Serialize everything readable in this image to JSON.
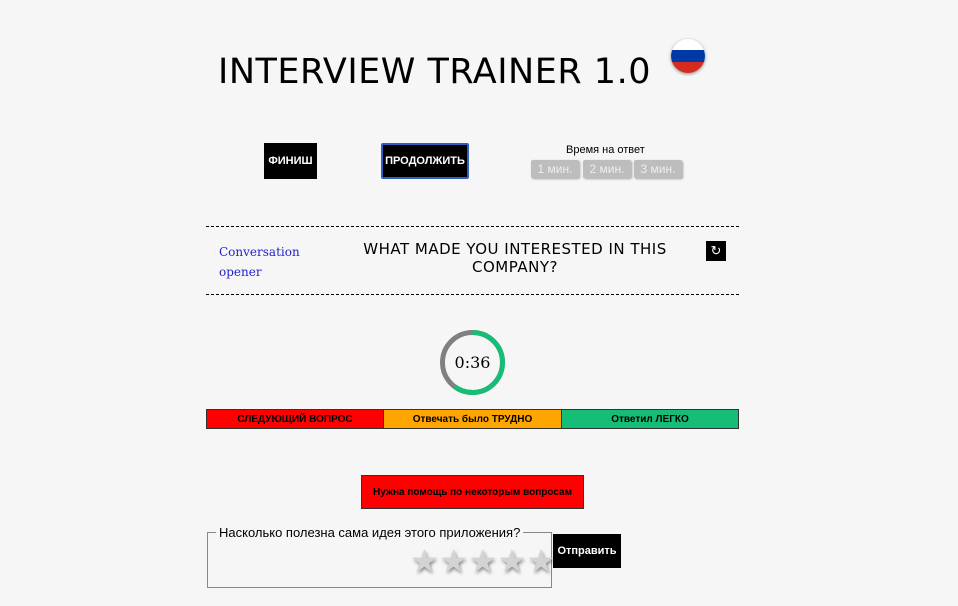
{
  "header": {
    "title": "INTERVIEW TRAINER 1.0",
    "language_flag": "russia-flag-icon"
  },
  "toolbar": {
    "finish_label": "ФИНИШ",
    "continue_label": "ПРОДОЛЖИТЬ",
    "time_label": "Время на ответ",
    "time_options": [
      "1 мин.",
      "2 мин.",
      "3 мин."
    ]
  },
  "question": {
    "category": "Conversation opener",
    "text": "WHAT MADE YOU INTERESTED IN THIS COMPANY?",
    "refresh_icon": "refresh-icon"
  },
  "timer": {
    "display": "0:36",
    "fraction_remaining": 0.6
  },
  "answer_bar": {
    "next_label": "СЛЕДУЮЩИЙ ВОПРОС",
    "hard_label": "Отвечать было ТРУДНО",
    "easy_label": "Ответил ЛЕГКО"
  },
  "help": {
    "label": "Нужна помощь по некоторым вопросам"
  },
  "feedback": {
    "legend": "Насколько полезна сама идея этого приложения?",
    "star_count": 5,
    "rating": 0,
    "submit_label": "Отправить"
  },
  "colors": {
    "red": "#ff0000",
    "orange": "#ffa500",
    "green": "#16bd76",
    "timer_ring": "#16bd76",
    "timer_track": "#808080",
    "link_blue": "#2222cc"
  }
}
